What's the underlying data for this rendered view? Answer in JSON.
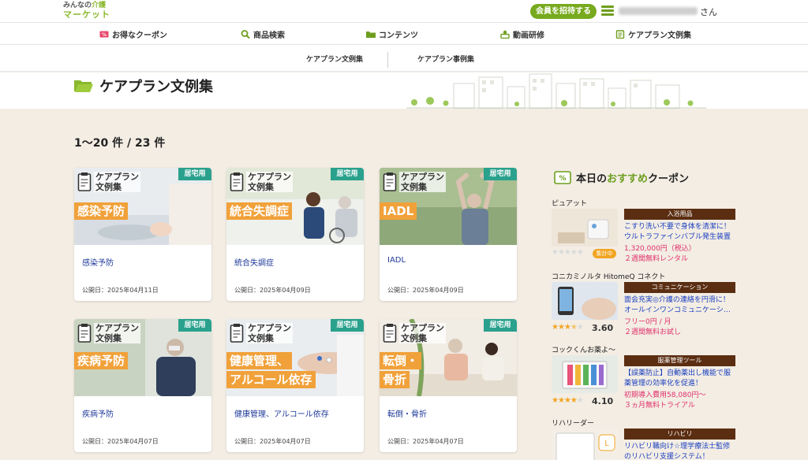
{
  "header": {
    "logo_line1_a": "みんなの",
    "logo_line1_b": "介護",
    "logo_line2": "マーケット",
    "invite_button": "会員を招待する",
    "user_suffix": "さん"
  },
  "nav": [
    {
      "label": "お得なクーポン",
      "icon": "coupon-icon"
    },
    {
      "label": "商品検索",
      "icon": "search-icon"
    },
    {
      "label": "コンテンツ",
      "icon": "folder-icon"
    },
    {
      "label": "動画研修",
      "icon": "video-training-icon"
    },
    {
      "label": "ケアプラン文例集",
      "icon": "clipboard-icon"
    }
  ],
  "subnav": [
    "ケアプラン文例集",
    "ケアプラン事例集"
  ],
  "page_title": "ケアプラン文例集",
  "result_count": "1〜20 件 / 23 件",
  "card_brand_line1": "ケアプラン",
  "card_brand_line2": "文例集",
  "cards": [
    {
      "tag": "居宅用",
      "caption": "感染予防",
      "title": "感染予防",
      "date": "公開日：2025年04月11日"
    },
    {
      "tag": "居宅用",
      "caption": "統合失調症",
      "title": "統合失調症",
      "date": "公開日：2025年04月09日"
    },
    {
      "tag": "居宅用",
      "caption": "IADL",
      "title": "IADL",
      "date": "公開日：2025年04月09日"
    },
    {
      "tag": "居宅用",
      "caption": "疾病予防",
      "title": "疾病予防",
      "date": "公開日：2025年04月07日"
    },
    {
      "tag": "居宅用",
      "caption": "健康管理、",
      "caption2": "アルコール依存",
      "title": "健康管理、アルコール依存",
      "date": "公開日：2025年04月07日"
    },
    {
      "tag": "居宅用",
      "caption": "転倒・",
      "caption2": "骨折",
      "title": "転倒・骨折",
      "date": "公開日：2025年04月07日"
    }
  ],
  "sidebar": {
    "title_prefix": "本日の",
    "title_highlight": "おすすめ",
    "title_suffix": "クーポン",
    "coupons": [
      {
        "vendor": "ピュアット",
        "category": "入浴用品",
        "desc1": "こすり洗い不要で身体を清潔に！",
        "desc2": "ウルトラファインバブル発生装置",
        "price": "1,320,000円（税込）",
        "offer": "２週間無料レンタル",
        "rating": "",
        "badge": "集計中",
        "stars": 0
      },
      {
        "vendor": "コニカミノルタ HitomeQ コネクト",
        "category": "コミュニケーション",
        "desc1": "面会充実◎介護の連絡を円滑に！",
        "desc2": "オールインワンコミュニケーシ…",
        "price": "フリー0円 / 月",
        "offer": "２週間無料お試し",
        "rating": "3.60",
        "badge": "",
        "stars": 3.6
      },
      {
        "vendor": "コックくんお薬よ〜",
        "category": "服薬管理ツール",
        "desc1": "【誤薬防止】自動薬出し機能で服",
        "desc2": "薬管理の効率化を促進！",
        "price": "初期導入費用58,080円〜",
        "offer": "３ヵ月無料トライアル",
        "rating": "4.10",
        "badge": "",
        "stars": 4.1
      },
      {
        "vendor": "リハリーダー",
        "category": "リハビリ",
        "desc1": "リハビリ職向け☆理学療法士監修",
        "desc2": "のリハビリ支援システム！",
        "price": "",
        "offer": "",
        "rating": "",
        "badge": "",
        "stars": 0
      }
    ]
  },
  "colors": {
    "brand_green": "#77aa1e",
    "tag_teal": "#2aa18d",
    "caption_orange": "#f1a13a",
    "category_brown": "#5b2e12",
    "link_blue": "#1f3a99",
    "price_pink": "#e0306a"
  }
}
